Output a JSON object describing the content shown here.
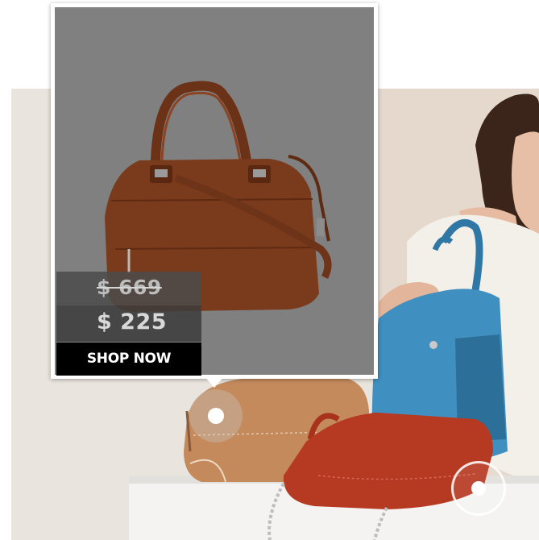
{
  "popup": {
    "price_old": "$ 669",
    "price_new": "$ 225",
    "shop_label": "SHOP NOW"
  },
  "icons": {
    "hotspot_active": "hotspot-marker",
    "hotspot_inactive": "hotspot-marker"
  },
  "colors": {
    "shop_button_bg": "#000000",
    "popup_bg": "#808080",
    "bag_brown": "#7a3a1c",
    "bag_blue": "#3f8fc0",
    "bag_tan": "#c48a5c",
    "bag_red": "#b63a22"
  }
}
